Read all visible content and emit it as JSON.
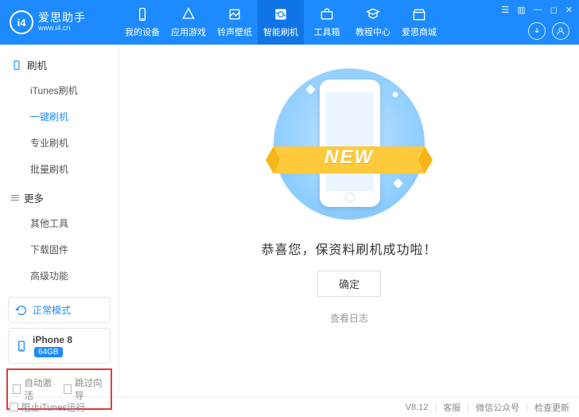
{
  "brand": {
    "badge": "i4",
    "title": "爱思助手",
    "subtitle": "www.i4.cn"
  },
  "nav": [
    {
      "label": "我的设备"
    },
    {
      "label": "应用游戏"
    },
    {
      "label": "铃声壁纸"
    },
    {
      "label": "智能刷机"
    },
    {
      "label": "工具箱"
    },
    {
      "label": "教程中心"
    },
    {
      "label": "爱思商城"
    }
  ],
  "sidebar": {
    "sections": [
      {
        "title": "刷机",
        "items": [
          {
            "label": "iTunes刷机"
          },
          {
            "label": "一键刷机"
          },
          {
            "label": "专业刷机"
          },
          {
            "label": "批量刷机"
          }
        ]
      },
      {
        "title": "更多",
        "items": [
          {
            "label": "其他工具"
          },
          {
            "label": "下载固件"
          },
          {
            "label": "高级功能"
          }
        ]
      }
    ],
    "mode": "正常模式",
    "device": {
      "name": "iPhone 8",
      "capacity": "64GB"
    },
    "checks": {
      "auto_activate": "自动激活",
      "skip_guide": "跳过向导"
    }
  },
  "main": {
    "ribbon": "NEW",
    "message": "恭喜您，保资料刷机成功啦！",
    "ok": "确定",
    "view_log": "查看日志"
  },
  "footer": {
    "block_itunes": "阻止iTunes运行",
    "version": "V8.12",
    "links": {
      "support": "客服",
      "wechat": "微信公众号",
      "update": "检查更新"
    }
  }
}
